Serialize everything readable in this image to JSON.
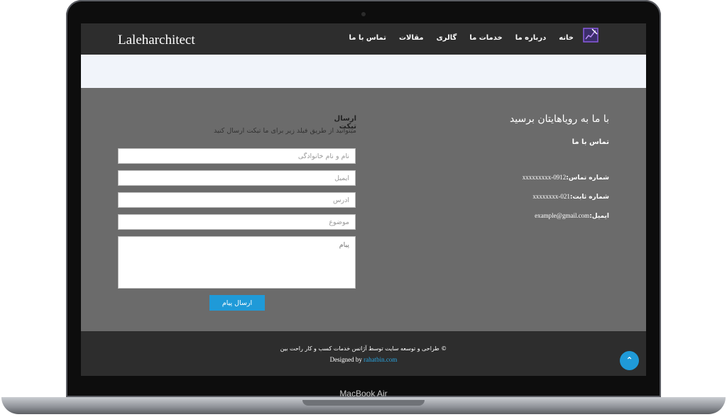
{
  "device": {
    "label": "MacBook Air"
  },
  "site": {
    "logo_text": "Laleharchitect",
    "nav": [
      "خانه",
      "درباره ما",
      "خدمات ما",
      "گالری",
      "مقالات",
      "تماس با ما"
    ]
  },
  "contact": {
    "heading": "با ما به رویاهایتان برسید",
    "subheading": "تماس با ما",
    "phone_label": "شماره تماس:",
    "phone_value": "0912-xxxxxxxxx",
    "landline_label": "شماره ثابت:",
    "landline_value": "021-xxxxxxxx",
    "email_label": "ایمیل:",
    "email_value": "example@gmail.com"
  },
  "form": {
    "title": "ارسال تیکت",
    "description": "میتوانید از طریق فیلد زیر برای ما تیکت ارسال کنید",
    "name_placeholder": "نام و نام خانوادگی",
    "email_placeholder": "ایمیل",
    "address_placeholder": "آدرس",
    "subject_placeholder": "موضوع",
    "message_placeholder": "پیام",
    "submit_label": "ارسال پیام"
  },
  "footer": {
    "copyright": "© طراحی و توسعه سایت توسط آژانس خدمات کسب و کار راحت بین",
    "credit_prefix": "Designed by",
    "credit_link": "rahatbin.com",
    "back_to_top_icon": "chevron-up-icon"
  },
  "colors": {
    "accent": "#1f9ad8",
    "nav_bg": "#2d2d2d",
    "body_bg": "#6b6b6b",
    "hero_bg": "#f1f4fa"
  }
}
